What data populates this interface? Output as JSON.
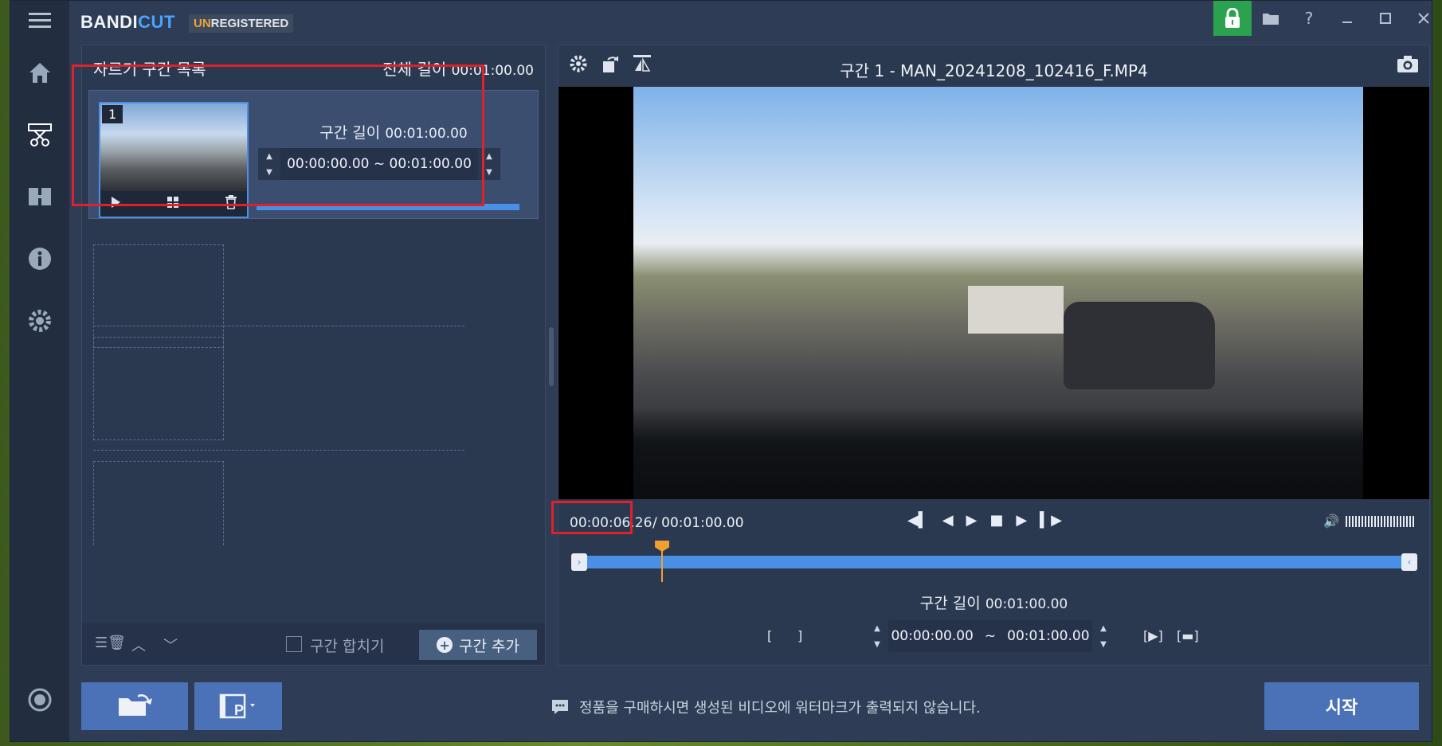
{
  "app": {
    "logo_part1": "BANDI",
    "logo_part2": "CUT",
    "unregistered_un": "UN",
    "unregistered_rest": "REGISTERED"
  },
  "sidebar": {
    "items": [
      {
        "icon": "menu-icon"
      },
      {
        "icon": "home-icon"
      },
      {
        "icon": "cut-icon",
        "active": true
      },
      {
        "icon": "join-icon"
      },
      {
        "icon": "info-icon"
      },
      {
        "icon": "settings-icon"
      },
      {
        "icon": "record-icon"
      }
    ]
  },
  "titlebar_buttons": [
    "lock-icon",
    "folder-icon",
    "help-icon",
    "minimize-icon",
    "maximize-icon",
    "close-icon"
  ],
  "left_panel": {
    "title": "자르기 구간 목록",
    "total_label": "전체 길이",
    "total_value": "00:01:00.00",
    "segment": {
      "number": "1",
      "length_label": "구간 길이",
      "length_value": "00:01:00.00",
      "range": "00:00:00.00 ~ 00:01:00.00",
      "progress": 1.0
    },
    "merge_label": "구간 합치기",
    "add_label": "구간 추가"
  },
  "right_panel": {
    "title": "구간 1 - MAN_20241208_102416_F.MP4",
    "current_time": "00:00:06.26",
    "total_time": "/ 00:01:00.00",
    "playhead_fraction": 0.105,
    "segment_length_label": "구간 길이",
    "segment_length_value": "00:01:00.00",
    "range_start": "00:00:00.00",
    "range_sep": "~",
    "range_end": "00:01:00.00"
  },
  "bottom": {
    "notice": "정품을 구매하시면 생성된 비디오에 워터마크가 출력되지 않습니다.",
    "start_label": "시작"
  },
  "colors": {
    "accent": "#4a8fe6",
    "highlight": "#e0202a",
    "playhead": "#f0a030",
    "lock_green": "#2ba24e"
  }
}
